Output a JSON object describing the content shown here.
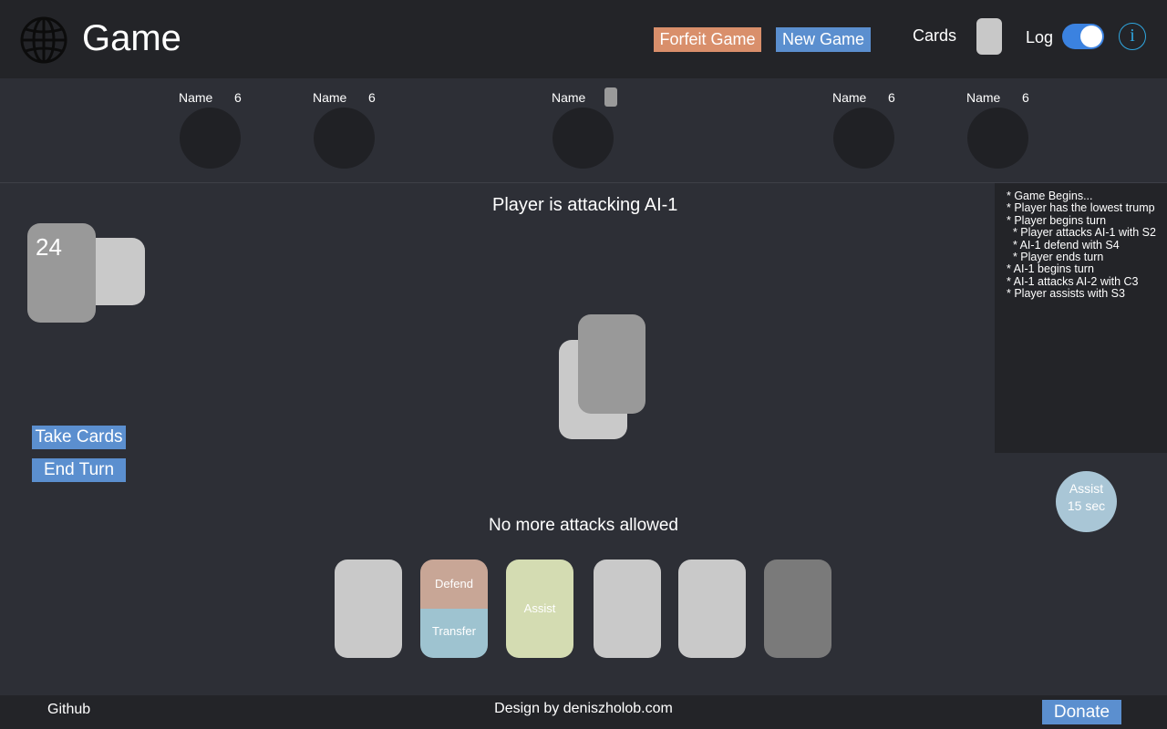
{
  "header": {
    "title": "Game",
    "forfeit_label": "Forfeit Game",
    "new_game_label": "New Game",
    "cards_label": "Cards",
    "log_label": "Log",
    "log_enabled": true,
    "info_glyph": "i",
    "logo_icon": "globe-icon"
  },
  "colors": {
    "forfeit": "#d98f6b",
    "primary_button": "#5b8fcf",
    "toggle_on": "#3b82e0",
    "info": "#2fa7e0",
    "defend": "#c8a696",
    "transfer": "#9ec3d0",
    "assist": "#d4dcb2"
  },
  "opponents": [
    {
      "name": "Name",
      "count": "6"
    },
    {
      "name": "Name",
      "count": "6"
    },
    {
      "name": "Name",
      "count": ""
    },
    {
      "name": "Name",
      "count": "6"
    },
    {
      "name": "Name",
      "count": "6"
    }
  ],
  "table": {
    "status": "Player is attacking AI-1",
    "deck_count": "24",
    "hint": "No more attacks allowed"
  },
  "actions": {
    "take_cards": "Take Cards",
    "end_turn": "End Turn"
  },
  "log": {
    "lines": [
      "* Game Begins...",
      "* Player has the lowest trump",
      "* Player begins turn",
      "  * Player attacks AI-1 with S2",
      "  * AI-1 defend with S4",
      "  * Player ends turn",
      "* AI-1 begins turn",
      "* AI-1 attacks AI-2 with C3",
      "* Player assists with S3"
    ]
  },
  "assist_timer": {
    "label": "Assist",
    "time": "15 sec"
  },
  "hand": {
    "defend_label": "Defend",
    "transfer_label": "Transfer",
    "assist_label": "Assist"
  },
  "footer": {
    "github": "Github",
    "credit": "Design by deniszholob.com",
    "donate": "Donate"
  }
}
